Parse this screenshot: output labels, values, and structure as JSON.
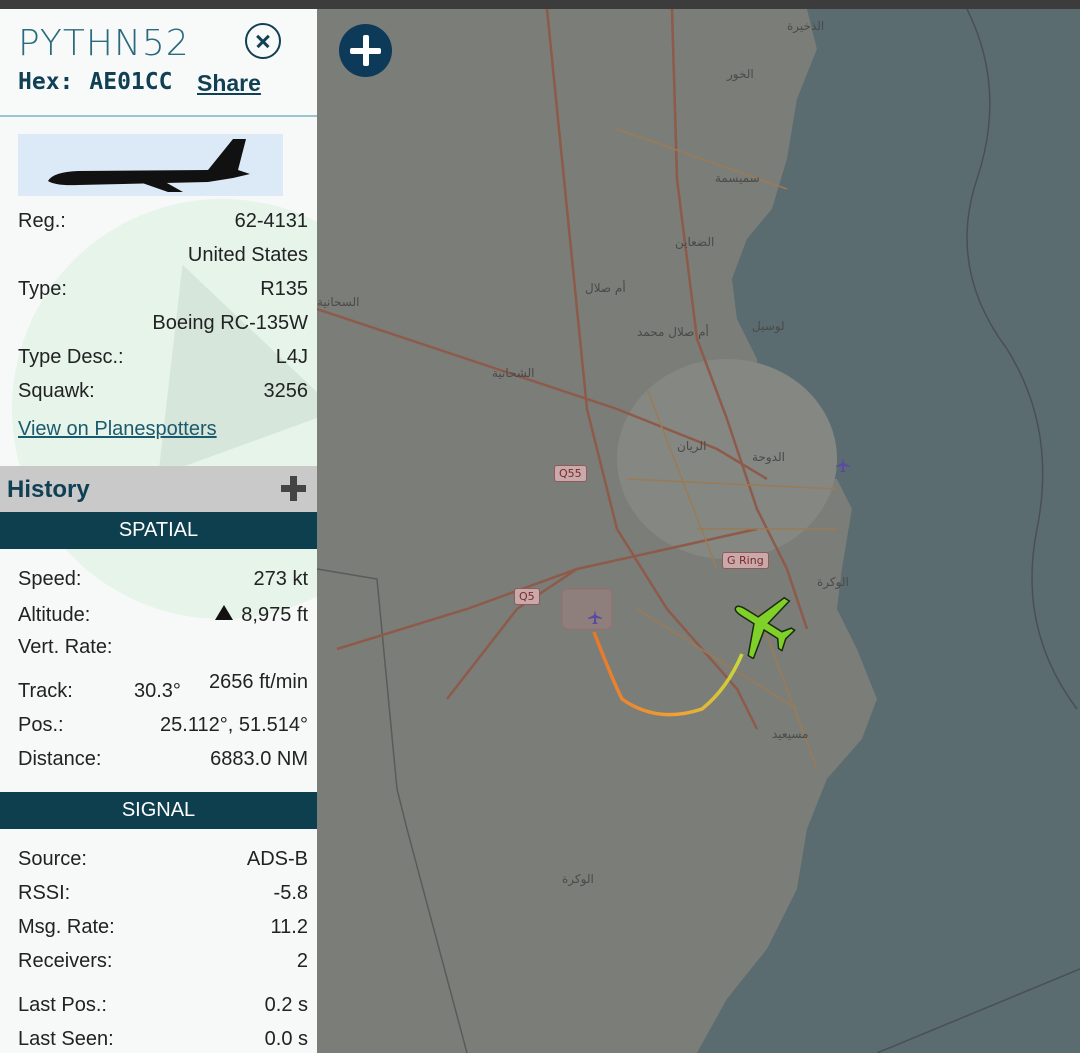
{
  "aircraft": {
    "callsign": "PYTHN52",
    "hex_label": "Hex:",
    "hex": "AE01CC",
    "share_label": "Share"
  },
  "details": {
    "reg_label": "Reg.:",
    "reg": "62-4131",
    "country": "United States",
    "type_label": "Type:",
    "type": "R135",
    "type_full": "Boeing RC-135W",
    "type_desc_label": "Type Desc.:",
    "type_desc": "L4J",
    "squawk_label": "Squawk:",
    "squawk": "3256",
    "planespotters_link": "View on Planespotters"
  },
  "history": {
    "title": "History"
  },
  "spatial": {
    "title": "SPATIAL",
    "speed_label": "Speed:",
    "speed": "273 kt",
    "altitude_label": "Altitude:",
    "altitude": "8,975 ft",
    "vert_rate_label": "Vert. Rate:",
    "track_label": "Track:",
    "track": "30.3°",
    "vert_rate": "2656 ft/min",
    "pos_label": "Pos.:",
    "pos": "25.112°, 51.514°",
    "distance_label": "Distance:",
    "distance": "6883.0 NM"
  },
  "signal": {
    "title": "SIGNAL",
    "source_label": "Source:",
    "source": "ADS-B",
    "rssi_label": "RSSI:",
    "rssi": "-5.8",
    "msg_rate_label": "Msg. Rate:",
    "msg_rate": "11.2",
    "receivers_label": "Receivers:",
    "receivers": "2",
    "last_pos_label": "Last Pos.:",
    "last_pos": "0.2 s",
    "last_seen_label": "Last Seen:",
    "last_seen": "0.0 s"
  },
  "map": {
    "labels": {
      "doha": "الدوحة",
      "rayyan": "الريان",
      "wakra_city": "الوكرة",
      "umm_salal": "أم صلال",
      "umm_salal_mohammed": "أم صلال محمد",
      "shahaniya": "الشحانية",
      "daayen": "الضعاين",
      "simaisma": "سميسمة",
      "khor": "الخور",
      "dhakhira": "الذخيرة",
      "wakra": "الوكرة",
      "mesaieed": "مسيعيد",
      "shahaniya2": "السحانية",
      "lusail": "لوسيل"
    },
    "shields": {
      "q55": "Q55",
      "q5": "Q5",
      "gring": "G Ring"
    }
  },
  "colors": {
    "accent": "#0e3f4e",
    "aircraft_marker": "#7fd12a",
    "track_start": "#e8772a",
    "track_end": "#c8d83a"
  }
}
